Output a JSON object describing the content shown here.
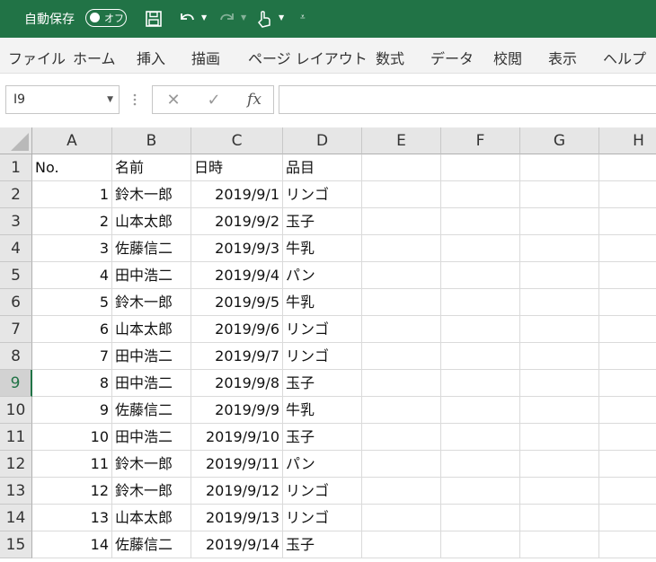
{
  "titlebar": {
    "autosave_label": "自動保存",
    "autosave_state": "オフ",
    "background": "#217346",
    "icons": [
      "save-icon",
      "undo-icon",
      "redo-icon",
      "touch-mode-icon",
      "customize-qat-icon"
    ]
  },
  "ribbon_tabs": [
    "ファイル",
    "ホーム",
    "挿入",
    "描画",
    "ページ レイアウト",
    "数式",
    "データ",
    "校閲",
    "表示",
    "ヘルプ"
  ],
  "formula_bar": {
    "name_box": "I9",
    "fx": "fx",
    "cancel": "✕",
    "enter": "✓",
    "formula": ""
  },
  "sheet": {
    "columns": [
      "A",
      "B",
      "C",
      "D",
      "E",
      "F",
      "G",
      "H"
    ],
    "selected_row": "9",
    "rows": [
      {
        "n": "1",
        "a": "No.",
        "b": "名前",
        "c": "日時",
        "d": "品目"
      },
      {
        "n": "2",
        "a": "1",
        "b": "鈴木一郎",
        "c": "2019/9/1",
        "d": "リンゴ"
      },
      {
        "n": "3",
        "a": "2",
        "b": "山本太郎",
        "c": "2019/9/2",
        "d": "玉子"
      },
      {
        "n": "4",
        "a": "3",
        "b": "佐藤信二",
        "c": "2019/9/3",
        "d": "牛乳"
      },
      {
        "n": "5",
        "a": "4",
        "b": "田中浩二",
        "c": "2019/9/4",
        "d": "パン"
      },
      {
        "n": "6",
        "a": "5",
        "b": "鈴木一郎",
        "c": "2019/9/5",
        "d": "牛乳"
      },
      {
        "n": "7",
        "a": "6",
        "b": "山本太郎",
        "c": "2019/9/6",
        "d": "リンゴ"
      },
      {
        "n": "8",
        "a": "7",
        "b": "田中浩二",
        "c": "2019/9/7",
        "d": "リンゴ"
      },
      {
        "n": "9",
        "a": "8",
        "b": "田中浩二",
        "c": "2019/9/8",
        "d": "玉子"
      },
      {
        "n": "10",
        "a": "9",
        "b": "佐藤信二",
        "c": "2019/9/9",
        "d": "牛乳"
      },
      {
        "n": "11",
        "a": "10",
        "b": "田中浩二",
        "c": "2019/9/10",
        "d": "玉子"
      },
      {
        "n": "12",
        "a": "11",
        "b": "鈴木一郎",
        "c": "2019/9/11",
        "d": "パン"
      },
      {
        "n": "13",
        "a": "12",
        "b": "鈴木一郎",
        "c": "2019/9/12",
        "d": "リンゴ"
      },
      {
        "n": "14",
        "a": "13",
        "b": "山本太郎",
        "c": "2019/9/13",
        "d": "リンゴ"
      },
      {
        "n": "15",
        "a": "14",
        "b": "佐藤信二",
        "c": "2019/9/14",
        "d": "玉子"
      }
    ]
  }
}
